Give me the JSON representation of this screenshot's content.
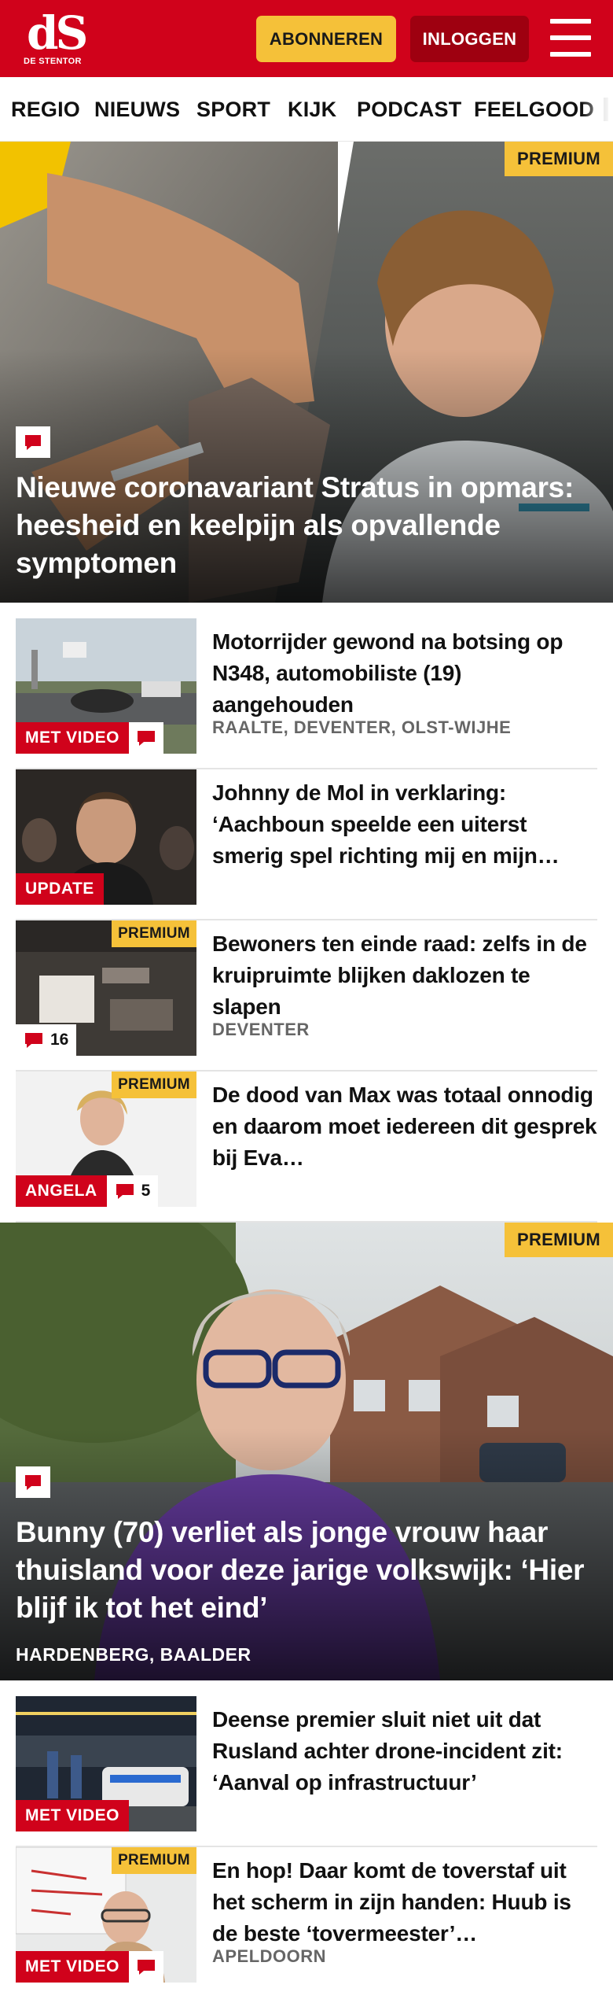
{
  "header": {
    "logo_text": "dS",
    "logo_subtitle": "DE STENTOR",
    "subscribe_label": "ABONNEREN",
    "login_label": "INLOGGEN",
    "menu_icon": "hamburger-icon"
  },
  "nav": {
    "items": [
      "REGIO",
      "NIEUWS",
      "SPORT",
      "KIJK",
      "PODCAST",
      "FEELGOOD"
    ]
  },
  "colors": {
    "brand_red": "#d0021b",
    "premium_yellow": "#f5c139",
    "login_dark_red": "#9e0010"
  },
  "hero1": {
    "premium": "PREMIUM",
    "title": "Nieuwe coronavariant Stratus in opmars: heesheid en keelpijn als opvallende symptomen",
    "icon": "comment-icon"
  },
  "articles": [
    {
      "title": "Motorrijder gewond na botsing op N348, automobiliste (19) aangehouden",
      "location": "RAALTE, DEVENTER, OLST-WIJHE",
      "label": "MET VIDEO",
      "icon": "comment-icon"
    },
    {
      "title": "Johnny de Mol in verklaring: ‘Aachboun speelde een uiterst smerig spel richting mij en mijn…",
      "label": "UPDATE"
    },
    {
      "title": "Bewoners ten einde raad: zelfs in de kruipruimte blijken daklozen te slapen",
      "location": "DEVENTER",
      "premium": "PREMIUM",
      "comment_count": "16",
      "icon": "comment-icon"
    },
    {
      "title": "De dood van Max was totaal onnodig en daarom moet iedereen dit gesprek bij Eva…",
      "premium": "PREMIUM",
      "label": "ANGELA",
      "comment_count": "5",
      "icon": "comment-icon"
    }
  ],
  "hero2": {
    "premium": "PREMIUM",
    "title": "Bunny (70) verliet als jonge vrouw haar thuisland voor deze jarige volkswijk: ‘Hier blijf ik tot het eind’",
    "location": "HARDENBERG, BAALDER",
    "icon": "comment-icon"
  },
  "articles2": [
    {
      "title": "Deense premier sluit niet uit dat Rusland achter drone-incident zit: ‘Aanval op infrastructuur’",
      "label": "MET VIDEO"
    },
    {
      "title": "En hop! Daar komt de toverstaf uit het scherm in zijn handen: Huub is de beste ‘tovermeester’…",
      "location": "APELDOORN",
      "premium": "PREMIUM",
      "label": "MET VIDEO",
      "icon": "comment-icon"
    }
  ]
}
